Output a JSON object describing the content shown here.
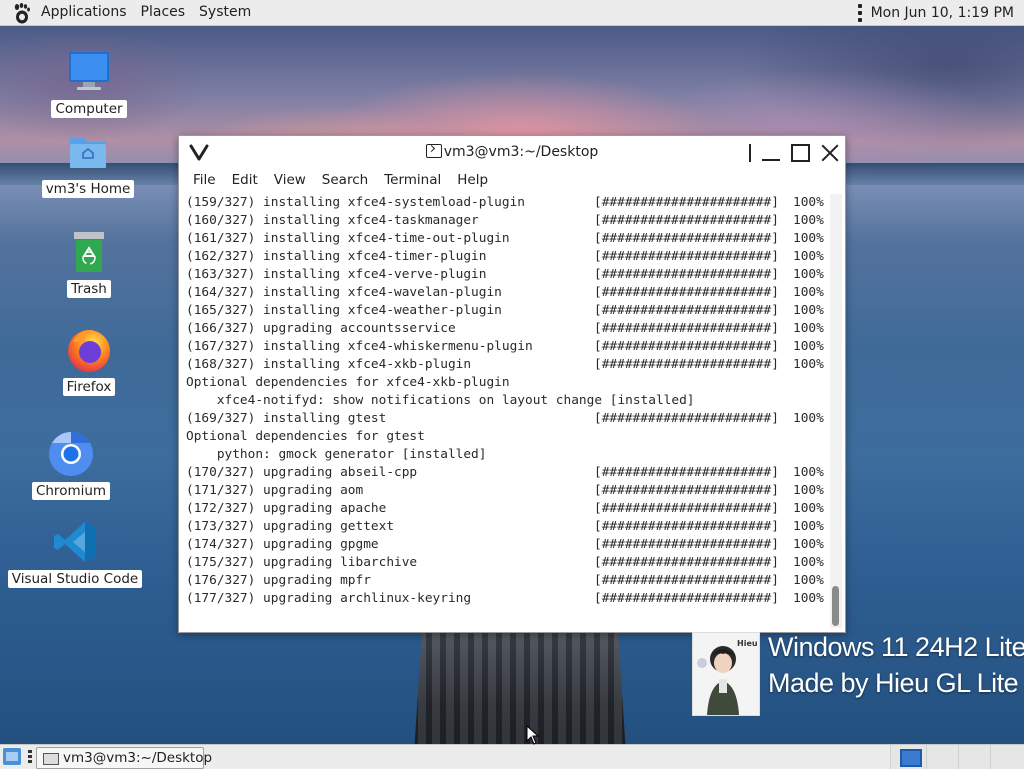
{
  "top_panel": {
    "menus": [
      "Applications",
      "Places",
      "System"
    ],
    "clock": "Mon Jun 10,  1:19 PM"
  },
  "desktop": {
    "icons": [
      {
        "label": "Computer",
        "icon": "computer-icon"
      },
      {
        "label": "vm3's Home",
        "icon": "home-folder-icon"
      },
      {
        "label": "Trash",
        "icon": "trash-icon"
      },
      {
        "label": "Firefox",
        "icon": "firefox-icon"
      },
      {
        "label": "Chromium",
        "icon": "chromium-icon"
      },
      {
        "label": "Visual Studio Code",
        "icon": "vscode-icon"
      }
    ],
    "watermark": {
      "line1": "Windows 11 24H2 Lite",
      "line2": "Made by Hieu GL Lite",
      "avatar_text": "Hieu"
    }
  },
  "terminal": {
    "title": "vm3@vm3:~/Desktop",
    "menus": [
      "File",
      "Edit",
      "View",
      "Search",
      "Terminal",
      "Help"
    ],
    "lines": [
      {
        "cmd": "(159/327) installing xfce4-systemload-plugin",
        "bar": "[######################]",
        "pct": "100%"
      },
      {
        "cmd": "(160/327) installing xfce4-taskmanager",
        "bar": "[######################]",
        "pct": "100%"
      },
      {
        "cmd": "(161/327) installing xfce4-time-out-plugin",
        "bar": "[######################]",
        "pct": "100%"
      },
      {
        "cmd": "(162/327) installing xfce4-timer-plugin",
        "bar": "[######################]",
        "pct": "100%"
      },
      {
        "cmd": "(163/327) installing xfce4-verve-plugin",
        "bar": "[######################]",
        "pct": "100%"
      },
      {
        "cmd": "(164/327) installing xfce4-wavelan-plugin",
        "bar": "[######################]",
        "pct": "100%"
      },
      {
        "cmd": "(165/327) installing xfce4-weather-plugin",
        "bar": "[######################]",
        "pct": "100%"
      },
      {
        "cmd": "(166/327) upgrading accountsservice",
        "bar": "[######################]",
        "pct": "100%"
      },
      {
        "cmd": "(167/327) installing xfce4-whiskermenu-plugin",
        "bar": "[######################]",
        "pct": "100%"
      },
      {
        "cmd": "(168/327) installing xfce4-xkb-plugin",
        "bar": "[######################]",
        "pct": "100%"
      },
      {
        "cmd": "Optional dependencies for xfce4-xkb-plugin",
        "bar": "",
        "pct": ""
      },
      {
        "cmd": "    xfce4-notifyd: show notifications on layout change [installed]",
        "bar": "",
        "pct": ""
      },
      {
        "cmd": "(169/327) installing gtest",
        "bar": "[######################]",
        "pct": "100%"
      },
      {
        "cmd": "Optional dependencies for gtest",
        "bar": "",
        "pct": ""
      },
      {
        "cmd": "    python: gmock generator [installed]",
        "bar": "",
        "pct": ""
      },
      {
        "cmd": "(170/327) upgrading abseil-cpp",
        "bar": "[######################]",
        "pct": "100%"
      },
      {
        "cmd": "(171/327) upgrading aom",
        "bar": "[######################]",
        "pct": "100%"
      },
      {
        "cmd": "(172/327) upgrading apache",
        "bar": "[######################]",
        "pct": "100%"
      },
      {
        "cmd": "(173/327) upgrading gettext",
        "bar": "[######################]",
        "pct": "100%"
      },
      {
        "cmd": "(174/327) upgrading gpgme",
        "bar": "[######################]",
        "pct": "100%"
      },
      {
        "cmd": "(175/327) upgrading libarchive",
        "bar": "[######################]",
        "pct": "100%"
      },
      {
        "cmd": "(176/327) upgrading mpfr",
        "bar": "[######################]",
        "pct": "100%"
      },
      {
        "cmd": "(177/327) upgrading archlinux-keyring",
        "bar": "[######################]",
        "pct": "100%"
      }
    ]
  },
  "taskbar": {
    "task_label": "vm3@vm3:~/Desktop",
    "workspaces": 4,
    "active_workspace": 1
  },
  "colors": {
    "panel_bg": "#ececec",
    "terminal_text": "#2a2a2a",
    "workspace_active": "#3a7ad0"
  }
}
